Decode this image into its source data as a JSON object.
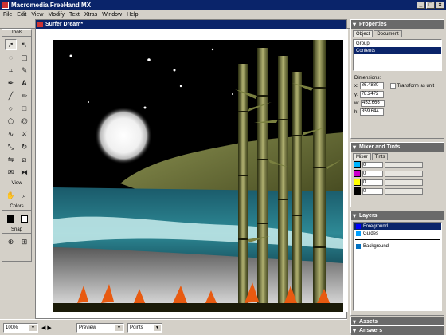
{
  "app": {
    "title": "Macromedia FreeHand MX",
    "window_buttons": [
      "_",
      "□",
      "×"
    ]
  },
  "menu": [
    "File",
    "Edit",
    "View",
    "Modify",
    "Text",
    "Xtras",
    "Window",
    "Help"
  ],
  "document": {
    "title": "Surfer Dream*"
  },
  "tools": {
    "title": "Tools",
    "view_title": "View",
    "colors_title": "Colors",
    "snap_title": "Snap",
    "stroke_color": "#000000",
    "fill_color": "#ffffff"
  },
  "properties": {
    "title": "Properties",
    "tabs": [
      "Object",
      "Document"
    ],
    "active_tab": "Object",
    "tree": [
      {
        "label": "Group",
        "selected": false
      },
      {
        "label": "Contents",
        "selected": true
      }
    ],
    "dimensions_label": "Dimensions:",
    "x_label": "x:",
    "x_value": "86.4880",
    "y_label": "y:",
    "y_value": "78.2472",
    "w_label": "w:",
    "w_value": "453.666",
    "h_label": "h:",
    "h_value": "359.644",
    "transform_checkbox_label": "Transform as unit"
  },
  "mixer": {
    "title": "Mixer and Tints",
    "tabs": [
      "Mixer",
      "Tints"
    ],
    "active_tab": "Mixer",
    "channels": [
      {
        "color": "#00b4ff",
        "value": "0"
      },
      {
        "color": "#cc00cc",
        "value": "0"
      },
      {
        "color": "#ffff00",
        "value": "0"
      },
      {
        "color": "#000000",
        "value": "0"
      }
    ]
  },
  "layers": {
    "title": "Layers",
    "items": [
      {
        "label": "Foreground",
        "color": "#0000ff",
        "selected": true
      },
      {
        "label": "Guides",
        "color": "#00a0ff",
        "selected": false
      },
      {
        "label": "Background",
        "color": "#0070c0",
        "selected": false
      }
    ]
  },
  "collapsed_panels": [
    "Assets",
    "Answers"
  ],
  "statusbar": {
    "zoom": "100%",
    "mode": "Preview",
    "units": "Points"
  }
}
